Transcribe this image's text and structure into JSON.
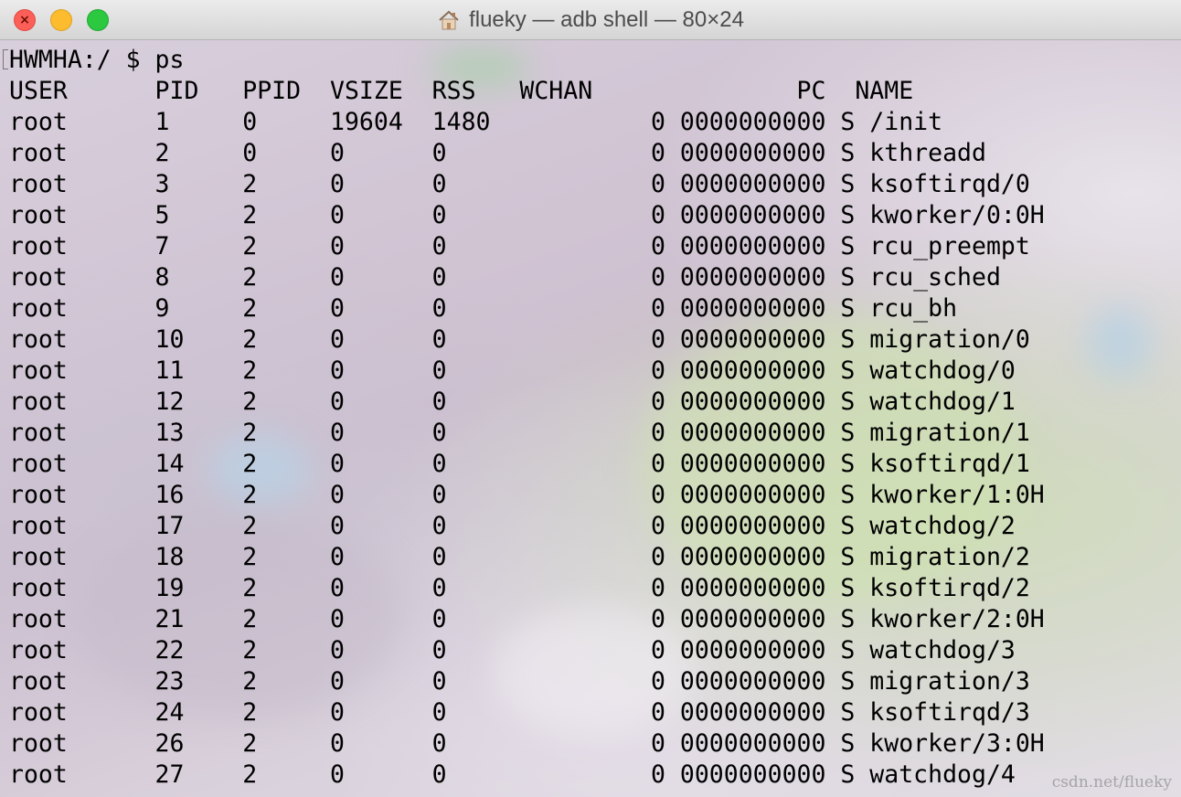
{
  "window": {
    "title": "flueky — adb shell — 80×24",
    "title_icon": "home-folder-icon",
    "close_glyph": "×"
  },
  "terminal": {
    "lines": [
      "HWMHA:/ $ ps",
      "USER      PID   PPID  VSIZE  RSS   WCHAN              PC  NAME",
      "root      1     0     19604  1480           0 0000000000 S /init",
      "root      2     0     0      0              0 0000000000 S kthreadd",
      "root      3     2     0      0              0 0000000000 S ksoftirqd/0",
      "root      5     2     0      0              0 0000000000 S kworker/0:0H",
      "root      7     2     0      0              0 0000000000 S rcu_preempt",
      "root      8     2     0      0              0 0000000000 S rcu_sched",
      "root      9     2     0      0              0 0000000000 S rcu_bh",
      "root      10    2     0      0              0 0000000000 S migration/0",
      "root      11    2     0      0              0 0000000000 S watchdog/0",
      "root      12    2     0      0              0 0000000000 S watchdog/1",
      "root      13    2     0      0              0 0000000000 S migration/1",
      "root      14    2     0      0              0 0000000000 S ksoftirqd/1",
      "root      16    2     0      0              0 0000000000 S kworker/1:0H",
      "root      17    2     0      0              0 0000000000 S watchdog/2",
      "root      18    2     0      0              0 0000000000 S migration/2",
      "root      19    2     0      0              0 0000000000 S ksoftirqd/2",
      "root      21    2     0      0              0 0000000000 S kworker/2:0H",
      "root      22    2     0      0              0 0000000000 S watchdog/3",
      "root      23    2     0      0              0 0000000000 S migration/3",
      "root      24    2     0      0              0 0000000000 S ksoftirqd/3",
      "root      26    2     0      0              0 0000000000 S kworker/3:0H",
      "root      27    2     0      0              0 0000000000 S watchdog/4"
    ]
  },
  "watermark": "csdn.net/flueky",
  "colors": {
    "traffic_close": "#fc5f57",
    "traffic_minimize": "#fdbc2e",
    "traffic_zoom": "#2bc840",
    "terminal_text": "#000000"
  }
}
